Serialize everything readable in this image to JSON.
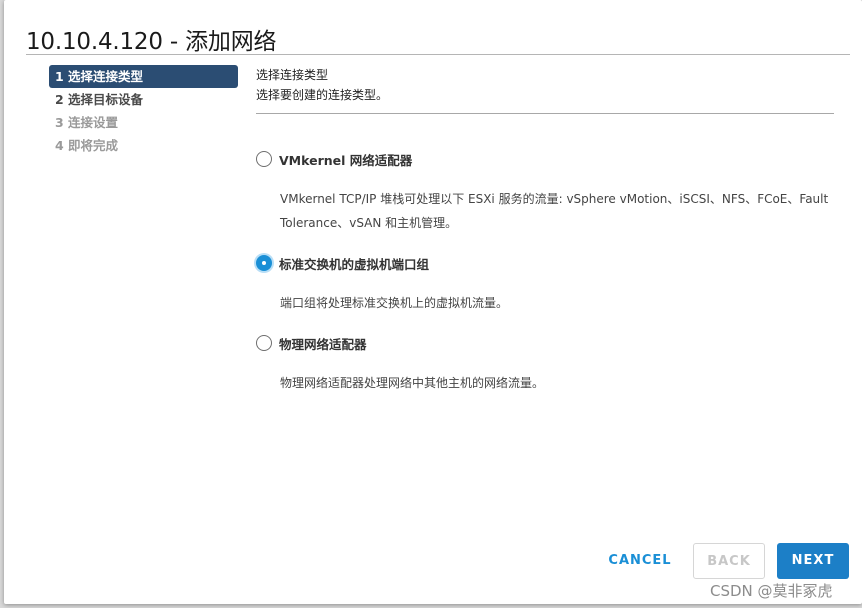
{
  "dialog": {
    "title": "10.10.4.120 - 添加网络"
  },
  "steps": [
    {
      "label": "1 选择连接类型",
      "state": "active"
    },
    {
      "label": "2 选择目标设备",
      "state": "enabled"
    },
    {
      "label": "3 连接设置",
      "state": "disabled"
    },
    {
      "label": "4 即将完成",
      "state": "disabled"
    }
  ],
  "content": {
    "title": "选择连接类型",
    "subtitle": "选择要创建的连接类型。",
    "options": [
      {
        "label": "VMkernel 网络适配器",
        "description": "VMkernel TCP/IP 堆栈可处理以下 ESXi 服务的流量: vSphere vMotion、iSCSI、NFS、FCoE、Fault Tolerance、vSAN 和主机管理。",
        "selected": false
      },
      {
        "label": "标准交换机的虚拟机端口组",
        "description": "端口组将处理标准交换机上的虚拟机流量。",
        "selected": true
      },
      {
        "label": "物理网络适配器",
        "description": "物理网络适配器处理网络中其他主机的网络流量。",
        "selected": false
      }
    ]
  },
  "footer": {
    "cancel_label": "CANCEL",
    "back_label": "BACK",
    "next_label": "NEXT"
  },
  "watermark": "CSDN @莫非冢虎",
  "colors": {
    "active_step_bg": "#2b4d73",
    "accent": "#1a8fd6",
    "next_button": "#1c7fc7"
  }
}
